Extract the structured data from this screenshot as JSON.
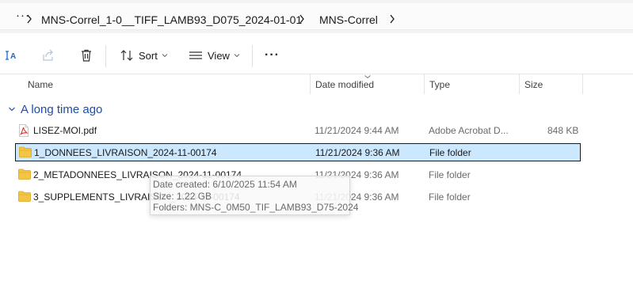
{
  "address_bar": {
    "more_label": "···",
    "breadcrumbs": [
      "MNS-Correl_1-0__TIFF_LAMB93_D075_2024-01-01",
      "MNS-Correl"
    ]
  },
  "toolbar": {
    "sort_label": "Sort",
    "view_label": "View",
    "more_label": "···"
  },
  "columns": {
    "name": "Name",
    "date_modified": "Date modified",
    "type": "Type",
    "size": "Size"
  },
  "group": {
    "label": "A long time ago"
  },
  "files": [
    {
      "name": "LISEZ-MOI.pdf",
      "date": "11/21/2024 9:44 AM",
      "type": "Adobe Acrobat D...",
      "size": "848 KB",
      "icon": "pdf-file-icon"
    },
    {
      "name": "1_DONNEES_LIVRAISON_2024-11-00174",
      "date": "11/21/2024 9:36 AM",
      "type": "File folder",
      "size": "",
      "icon": "folder-icon"
    },
    {
      "name": "2_METADONNEES_LIVRAISON_2024-11-00174",
      "date": "11/21/2024 9:36 AM",
      "type": "File folder",
      "size": "",
      "icon": "folder-icon"
    },
    {
      "name": "3_SUPPLEMENTS_LIVRAISON_2024-11-00174",
      "date": "11/21/2024 9:36 AM",
      "type": "File folder",
      "size": "",
      "icon": "folder-icon"
    }
  ],
  "tooltip": {
    "created": "Date created: 6/10/2025 11:54 AM",
    "size": "Size: 1.22 GB",
    "folders": "Folders: MNS-C_0M50_TIF_LAMB93_D75-2024"
  },
  "colors": {
    "selection_bg": "#cce8ff",
    "group_header": "#1e4ea8",
    "folder": "#f4c542",
    "pdf": "#d9342b"
  }
}
